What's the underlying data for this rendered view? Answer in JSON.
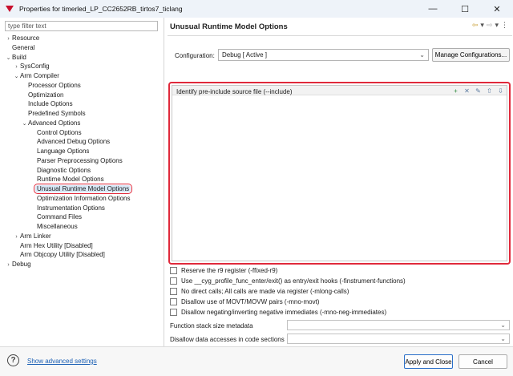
{
  "window": {
    "title": "Properties for timerled_LP_CC2652RB_tirtos7_ticlang",
    "controls": {
      "minimize": "—",
      "maximize": "☐",
      "close": "✕"
    }
  },
  "filter": {
    "placeholder": "type filter text"
  },
  "tree": [
    {
      "label": "Resource",
      "level": 0,
      "twisty": "›"
    },
    {
      "label": "General",
      "level": 0,
      "twisty": ""
    },
    {
      "label": "Build",
      "level": 0,
      "twisty": "⌄"
    },
    {
      "label": "SysConfig",
      "level": 1,
      "twisty": "›"
    },
    {
      "label": "Arm Compiler",
      "level": 1,
      "twisty": "⌄"
    },
    {
      "label": "Processor Options",
      "level": 2,
      "twisty": ""
    },
    {
      "label": "Optimization",
      "level": 2,
      "twisty": ""
    },
    {
      "label": "Include Options",
      "level": 2,
      "twisty": ""
    },
    {
      "label": "Predefined Symbols",
      "level": 2,
      "twisty": ""
    },
    {
      "label": "Advanced Options",
      "level": 2,
      "twisty": "⌄"
    },
    {
      "label": "Control Options",
      "level": 3,
      "twisty": ""
    },
    {
      "label": "Advanced Debug Options",
      "level": 3,
      "twisty": ""
    },
    {
      "label": "Language Options",
      "level": 3,
      "twisty": ""
    },
    {
      "label": "Parser Preprocessing Options",
      "level": 3,
      "twisty": ""
    },
    {
      "label": "Diagnostic Options",
      "level": 3,
      "twisty": ""
    },
    {
      "label": "Runtime Model Options",
      "level": 3,
      "twisty": ""
    },
    {
      "label": "Unusual Runtime Model Options",
      "level": 3,
      "twisty": "",
      "selected": true
    },
    {
      "label": "Optimization Information Options",
      "level": 3,
      "twisty": ""
    },
    {
      "label": "Instrumentation Options",
      "level": 3,
      "twisty": ""
    },
    {
      "label": "Command Files",
      "level": 3,
      "twisty": ""
    },
    {
      "label": "Miscellaneous",
      "level": 3,
      "twisty": ""
    },
    {
      "label": "Arm Linker",
      "level": 1,
      "twisty": "›"
    },
    {
      "label": "Arm Hex Utility  [Disabled]",
      "level": 1,
      "twisty": ""
    },
    {
      "label": "Arm Objcopy Utility  [Disabled]",
      "level": 1,
      "twisty": ""
    },
    {
      "label": "Debug",
      "level": 0,
      "twisty": "›"
    }
  ],
  "page": {
    "title": "Unusual Runtime Model Options",
    "nav": {
      "back": "⇦",
      "back_menu": "▾",
      "forward": "⇨",
      "forward_menu": "▾",
      "more": "⋮"
    }
  },
  "configuration": {
    "label": "Configuration:",
    "value": "Debug  [ Active ]",
    "manage_label": "Manage Configurations..."
  },
  "include_list": {
    "label": "Identify pre-include source file (--include)",
    "tools": [
      {
        "name": "add-icon",
        "glyph": "+"
      },
      {
        "name": "delete-icon",
        "glyph": "✕"
      },
      {
        "name": "edit-icon",
        "glyph": "✎"
      },
      {
        "name": "move-up-icon",
        "glyph": "⇧"
      },
      {
        "name": "move-down-icon",
        "glyph": "⇩"
      }
    ]
  },
  "options": [
    "Reserve the r9 register (-ffixed-r9)",
    "Use __cyg_profile_func_enter/exit() as entry/exit hooks (-finstrument-functions)",
    "No direct calls; All calls are made via register (-mlong-calls)",
    "Disallow use of MOVT/MOVW pairs (-mno-movt)",
    "Disallow negating/inverting negative immediates (-mno-neg-immediates)"
  ],
  "fields": [
    {
      "label": "Function stack size metadata",
      "value": ""
    },
    {
      "label": "Disallow data accesses in code sections",
      "value": ""
    }
  ],
  "bottom": {
    "help": "?",
    "advanced_link": "Show advanced settings",
    "apply_close": "Apply and Close",
    "cancel": "Cancel"
  },
  "colors": {
    "highlight": "#e0293b",
    "link": "#1a5fb4",
    "primary_border": "#2a6fc9"
  }
}
